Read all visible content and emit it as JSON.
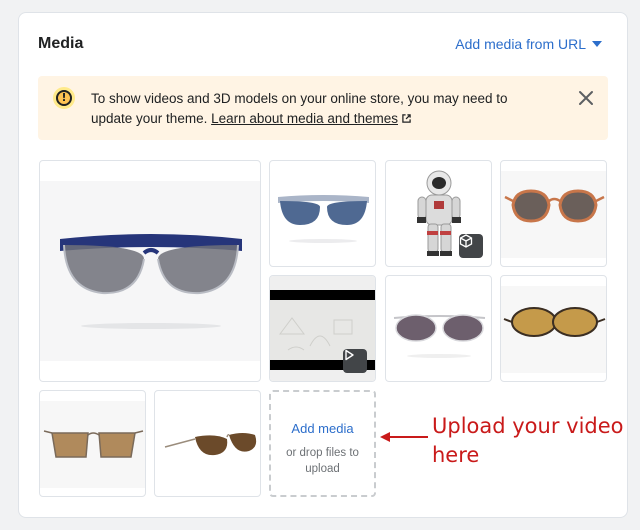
{
  "media": {
    "title": "Media",
    "add_from_url": "Add media from URL"
  },
  "banner": {
    "text": "To show videos and 3D models on your online store, you may need to update your theme.",
    "link": "Learn about media and themes"
  },
  "gallery": {
    "items": [
      {
        "type": "image",
        "label": "blue-rimmed-sunglasses"
      },
      {
        "type": "image",
        "label": "blue-lens-sunglasses"
      },
      {
        "type": "3d-model",
        "label": "astronaut-model"
      },
      {
        "type": "image",
        "label": "orange-frame-sunglasses"
      },
      {
        "type": "video",
        "label": "sketch-video"
      },
      {
        "type": "image",
        "label": "round-clear-sunglasses"
      },
      {
        "type": "image",
        "label": "gold-round-sunglasses"
      },
      {
        "type": "image",
        "label": "square-aviator-sunglasses"
      },
      {
        "type": "image",
        "label": "aviator-sunglasses"
      }
    ]
  },
  "dropzone": {
    "add_label": "Add media",
    "hint": "or drop files to upload"
  },
  "annotation": {
    "text": "Upload your video here",
    "color": "#c91a1a"
  },
  "colors": {
    "link": "#2c6ecb",
    "banner_bg": "#fff4e4",
    "warning": "#ffc453"
  }
}
